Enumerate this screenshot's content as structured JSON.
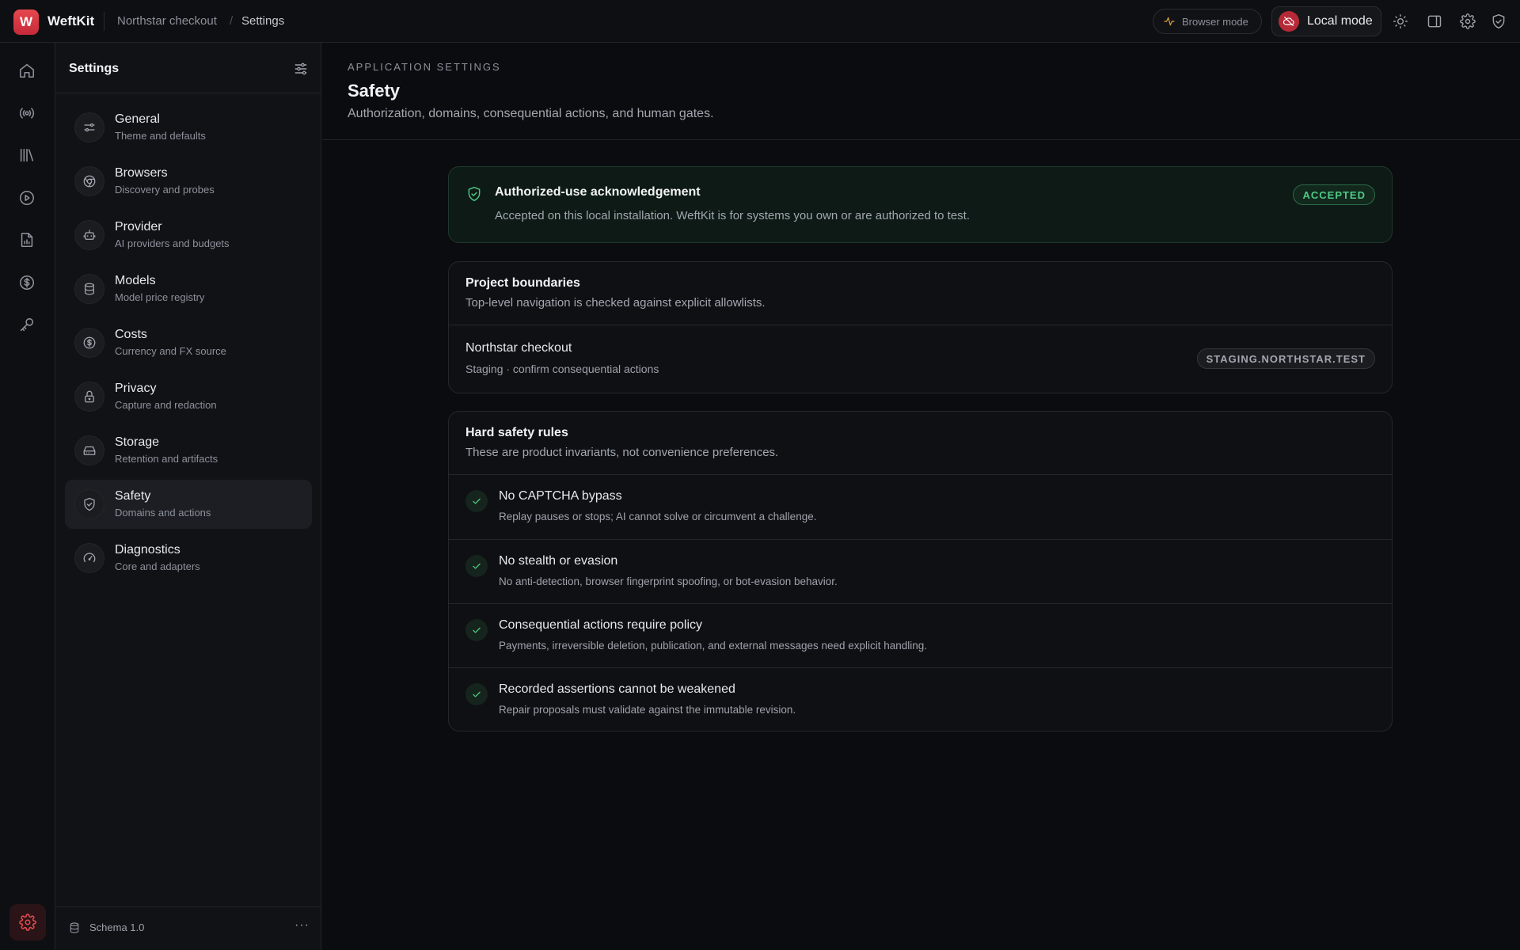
{
  "app": {
    "logo_letter": "W",
    "name": "WeftKit",
    "breadcrumb": [
      "Northstar checkout",
      "/",
      "Settings"
    ],
    "browser_mode_label": "Browser mode",
    "local_mode_label": "Local mode"
  },
  "sidebar": {
    "title": "Settings",
    "items": [
      {
        "label": "General",
        "sub": "Theme and defaults",
        "icon": "sliders-icon"
      },
      {
        "label": "Browsers",
        "sub": "Discovery and probes",
        "icon": "browser-icon"
      },
      {
        "label": "Provider",
        "sub": "AI providers and budgets",
        "icon": "bot-icon"
      },
      {
        "label": "Models",
        "sub": "Model price registry",
        "icon": "database-icon"
      },
      {
        "label": "Costs",
        "sub": "Currency and FX source",
        "icon": "dollar-icon"
      },
      {
        "label": "Privacy",
        "sub": "Capture and redaction",
        "icon": "lock-icon"
      },
      {
        "label": "Storage",
        "sub": "Retention and artifacts",
        "icon": "drive-icon"
      },
      {
        "label": "Safety",
        "sub": "Domains and actions",
        "icon": "shield-icon",
        "active": true
      },
      {
        "label": "Diagnostics",
        "sub": "Core and adapters",
        "icon": "gauge-icon"
      }
    ],
    "footer_label": "Schema 1.0",
    "footer_more": "···"
  },
  "page": {
    "eyebrow": "APPLICATION SETTINGS",
    "title": "Safety",
    "description": "Authorization, domains, consequential actions, and human gates."
  },
  "ack": {
    "title": "Authorized-use acknowledgement",
    "description": "Accepted on this local installation. WeftKit is for systems you own or are authorized to test.",
    "badge": "ACCEPTED"
  },
  "boundaries": {
    "title": "Project boundaries",
    "description": "Top-level navigation is checked against explicit allowlists.",
    "project_name": "Northstar checkout",
    "project_sub": "Staging · confirm consequential actions",
    "domain": "STAGING.NORTHSTAR.TEST"
  },
  "rules": {
    "title": "Hard safety rules",
    "description": "These are product invariants, not convenience preferences.",
    "items": [
      {
        "title": "No CAPTCHA bypass",
        "desc": "Replay pauses or stops; AI cannot solve or circumvent a challenge."
      },
      {
        "title": "No stealth or evasion",
        "desc": "No anti-detection, browser fingerprint spoofing, or bot-evasion behavior."
      },
      {
        "title": "Consequential actions require policy",
        "desc": "Payments, irreversible deletion, publication, and external messages need explicit handling."
      },
      {
        "title": "Recorded assertions cannot be weakened",
        "desc": "Repair proposals must validate against the immutable revision."
      }
    ]
  },
  "colors": {
    "accent": "#e5484d",
    "success": "#4fc985",
    "background": "#0b0c0f"
  }
}
